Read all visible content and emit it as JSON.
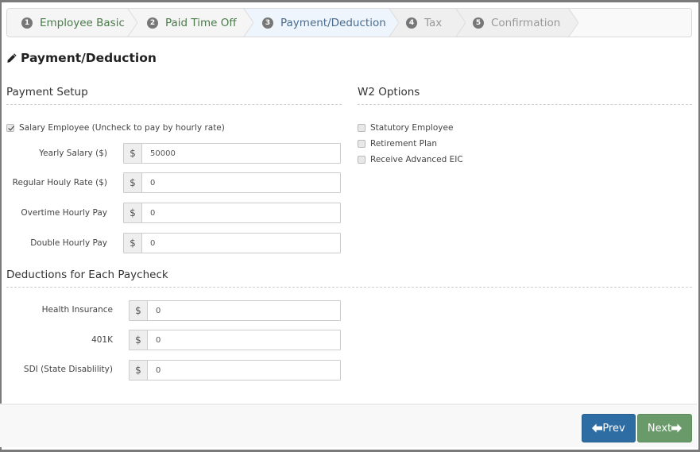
{
  "wizard": {
    "steps": [
      {
        "number": "1",
        "label": "Employee Basic",
        "state": "done"
      },
      {
        "number": "2",
        "label": "Paid Time Off",
        "state": "done"
      },
      {
        "number": "3",
        "label": "Payment/Deduction",
        "state": "active"
      },
      {
        "number": "4",
        "label": "Tax",
        "state": "todo"
      },
      {
        "number": "5",
        "label": "Confirmation",
        "state": "todo"
      }
    ]
  },
  "page": {
    "title": "Payment/Deduction",
    "title_icon": "pencil-icon"
  },
  "payment_setup": {
    "heading": "Payment Setup",
    "salary_checkbox": {
      "label": "Salary Employee (Uncheck to pay by hourly rate)",
      "checked": true
    },
    "fields": [
      {
        "label": "Yearly Salary ($)",
        "prefix": "$",
        "value": "50000"
      },
      {
        "label": "Regular Houly Rate ($)",
        "prefix": "$",
        "value": "0"
      },
      {
        "label": "Overtime Hourly Pay",
        "prefix": "$",
        "value": "0"
      },
      {
        "label": "Double Hourly Pay",
        "prefix": "$",
        "value": "0"
      }
    ]
  },
  "w2_options": {
    "heading": "W2 Options",
    "options": [
      {
        "label": "Statutory Employee",
        "checked": false
      },
      {
        "label": "Retirement Plan",
        "checked": false
      },
      {
        "label": "Receive Advanced EIC",
        "checked": false
      }
    ]
  },
  "deductions": {
    "heading": "Deductions for Each Paycheck",
    "fields": [
      {
        "label": "Health Insurance",
        "prefix": "$",
        "value": "0"
      },
      {
        "label": "401K",
        "prefix": "$",
        "value": "0"
      },
      {
        "label": "SDI (State Disablility)",
        "prefix": "$",
        "value": "0"
      }
    ]
  },
  "footer": {
    "prev_label": "Prev",
    "next_label": "Next",
    "prev_icon": "arrow-left-icon",
    "next_icon": "arrow-right-icon"
  },
  "colors": {
    "prev_button": "#2e6da4",
    "next_button": "#6a9a6a",
    "active_step_bg": "#eef5fc"
  }
}
